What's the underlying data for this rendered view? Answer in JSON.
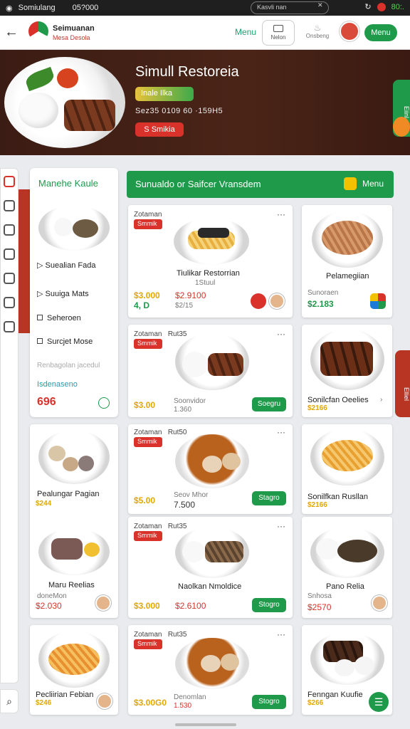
{
  "status": {
    "left1": "Somiulang",
    "left2": "05?000",
    "search": "Kasvli nan",
    "right": "80:."
  },
  "topbar": {
    "brand1": "Seimuanan",
    "brand2": "Mesa Desola",
    "menu_link": "Menu",
    "box_label": "Nelon",
    "ongoing": "Onsbeng",
    "menu_button": "Menu"
  },
  "hero": {
    "title": "Simull Restoreia",
    "badge": "Inale Ilka",
    "info": "Sez35  0109  60 ·159H5",
    "button": "S Smikia"
  },
  "side_tab": "Eiinl",
  "right_tab": "Elliel",
  "filters": {
    "title": "Manehe Kaule",
    "items": [
      "Suealian Fada",
      "Suuiga Mats",
      "Seheroen",
      "Surcjet Mose"
    ],
    "note1": "Renbagolan jacedul",
    "note2": "Isdenaseno",
    "value": "696"
  },
  "banner": {
    "title": "Sunualdo or Saifcer Vransdem",
    "menu": "Menu"
  },
  "cards": [
    {
      "tag": "Zotaman",
      "badge": "Smmik",
      "title": "Tiulikar Restorrian",
      "sub": "1Stuul",
      "price1": "$3.000",
      "price2": "$2.9100",
      "green": "4, D",
      "sub2": "$2/15"
    },
    {
      "title": "Pelamegiian",
      "sub": "Sunoraen",
      "price": "$2.183"
    },
    {
      "tag": "Zotaman",
      "tag2": "Rut35",
      "badge": "Smmik",
      "sub": "Soonvidor",
      "price1": "$3.00",
      "sub2": "1.360",
      "button": "Soegru"
    },
    {
      "title": "Sonilcfan Oeelies",
      "price": "$2166"
    },
    {
      "left_title": "Pealungar Pagian",
      "left_price": "$244"
    },
    {
      "tag": "Zotaman",
      "tag2": "Rut50",
      "badge": "Smmik",
      "sub": "Seov Mhor",
      "price1": "$5.00",
      "green": "7.500",
      "button": "Stagro"
    },
    {
      "title": "Sonilfkan Rusllan",
      "price": "$2166"
    },
    {
      "left_title": "Maru Reelias",
      "left_sub": "doneMon",
      "left_price": "$2.030"
    },
    {
      "tag": "Zotaman",
      "tag2": "Rut35",
      "badge": "Smmik",
      "title": "Naolkan Nmoldice",
      "price1": "$3.000",
      "price2": "$2.6100",
      "button": "Stogro"
    },
    {
      "title": "Pano Relia",
      "sub": "Snhosa",
      "price": "$2570"
    },
    {
      "left_title": "Pecliirian Febian",
      "left_price": "$246"
    },
    {
      "tag": "Zotaman",
      "tag2": "Rut35",
      "badge": "Smmik",
      "sub": "Denomlan",
      "price1": "$3.00G0",
      "sub2": "1.530",
      "button": "Stogro"
    },
    {
      "title": "Fenngan Kuufie",
      "price": "$266"
    }
  ]
}
